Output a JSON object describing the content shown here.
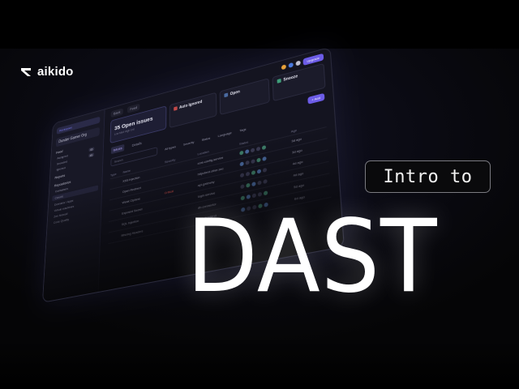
{
  "brand": {
    "name": "aikido",
    "logo_icon": "aikido-logo-icon",
    "accent": "#6c5ce7"
  },
  "dashboard": {
    "sidebar": {
      "workspace_badge": "Workspace",
      "workspace_name": "Dunder Gamer Org",
      "groups": [
        {
          "label": "Feed",
          "items": [
            {
              "label": "Assigned",
              "count": "35"
            },
            {
              "label": "Snoozed",
              "count": "35"
            },
            {
              "label": "Ignored",
              "count": ""
            }
          ]
        },
        {
          "label": "Reports",
          "items": []
        },
        {
          "label": "Repositories",
          "items": [
            {
              "label": "Containers",
              "count": ""
            },
            {
              "label": "Clouds",
              "count": ""
            },
            {
              "label": "Domains / Apps",
              "count": ""
            },
            {
              "label": "Virtual machines",
              "count": ""
            },
            {
              "label": "Zen firewall",
              "count": ""
            },
            {
              "label": "Code Quality",
              "count": ""
            }
          ]
        }
      ]
    },
    "topbar": {
      "crumbs": [
        "Back",
        "Feed"
      ],
      "upgrade": "Upgrade"
    },
    "cards": [
      {
        "title": "35 Open issues",
        "sub": "Low  Med  High  Crit"
      },
      {
        "title": "Auto Ignored",
        "sub": ""
      },
      {
        "title": "Open",
        "sub": ""
      },
      {
        "title": "Snooze",
        "sub": ""
      }
    ],
    "tabs": [
      "Issues",
      "Details"
    ],
    "tab_button": "+ Add",
    "search_placeholder": "Search",
    "filters": [
      "All types",
      "Severity",
      "Status",
      "Language",
      "Tags"
    ],
    "table": {
      "headers": [
        "Type",
        "Name",
        "Severity",
        "Location",
        "Status",
        "Age"
      ],
      "rows": [
        {
          "type": "",
          "name": "XSS Injection",
          "severity": "",
          "location": "cors-config.service",
          "age": "3d ago"
        },
        {
          "type": "",
          "name": "Open Redirect",
          "severity": "",
          "location": "httpclient.other.sec",
          "age": "3d ago"
        },
        {
          "type": "",
          "name": "Weak Ciphers",
          "severity": "Critical",
          "location": "api-gateway",
          "age": "4d ago"
        },
        {
          "type": "",
          "name": "Exposed Secret",
          "severity": "",
          "location": "login.service",
          "age": "4d ago"
        },
        {
          "type": "",
          "name": "SQL Injection",
          "severity": "",
          "location": "db-connector",
          "age": "5d ago"
        },
        {
          "type": "",
          "name": "Missing Headers",
          "severity": "",
          "location": "web-frontend",
          "age": "6d ago"
        }
      ]
    }
  },
  "intro_label": "Intro to",
  "headline": "DAST"
}
